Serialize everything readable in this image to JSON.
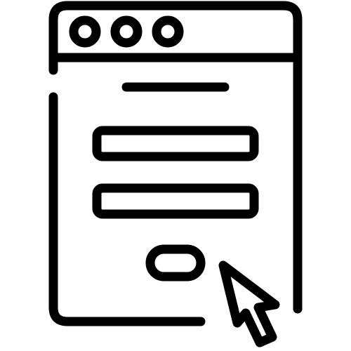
{
  "icon": {
    "name": "login-form-window-icon",
    "color": "#000000",
    "background": "#ffffff",
    "window_controls": [
      "window-dot-icon",
      "window-dot-icon",
      "window-dot-icon"
    ],
    "form_fields": [
      "text-field",
      "text-field"
    ],
    "cursor": "cursor-arrow-icon"
  }
}
